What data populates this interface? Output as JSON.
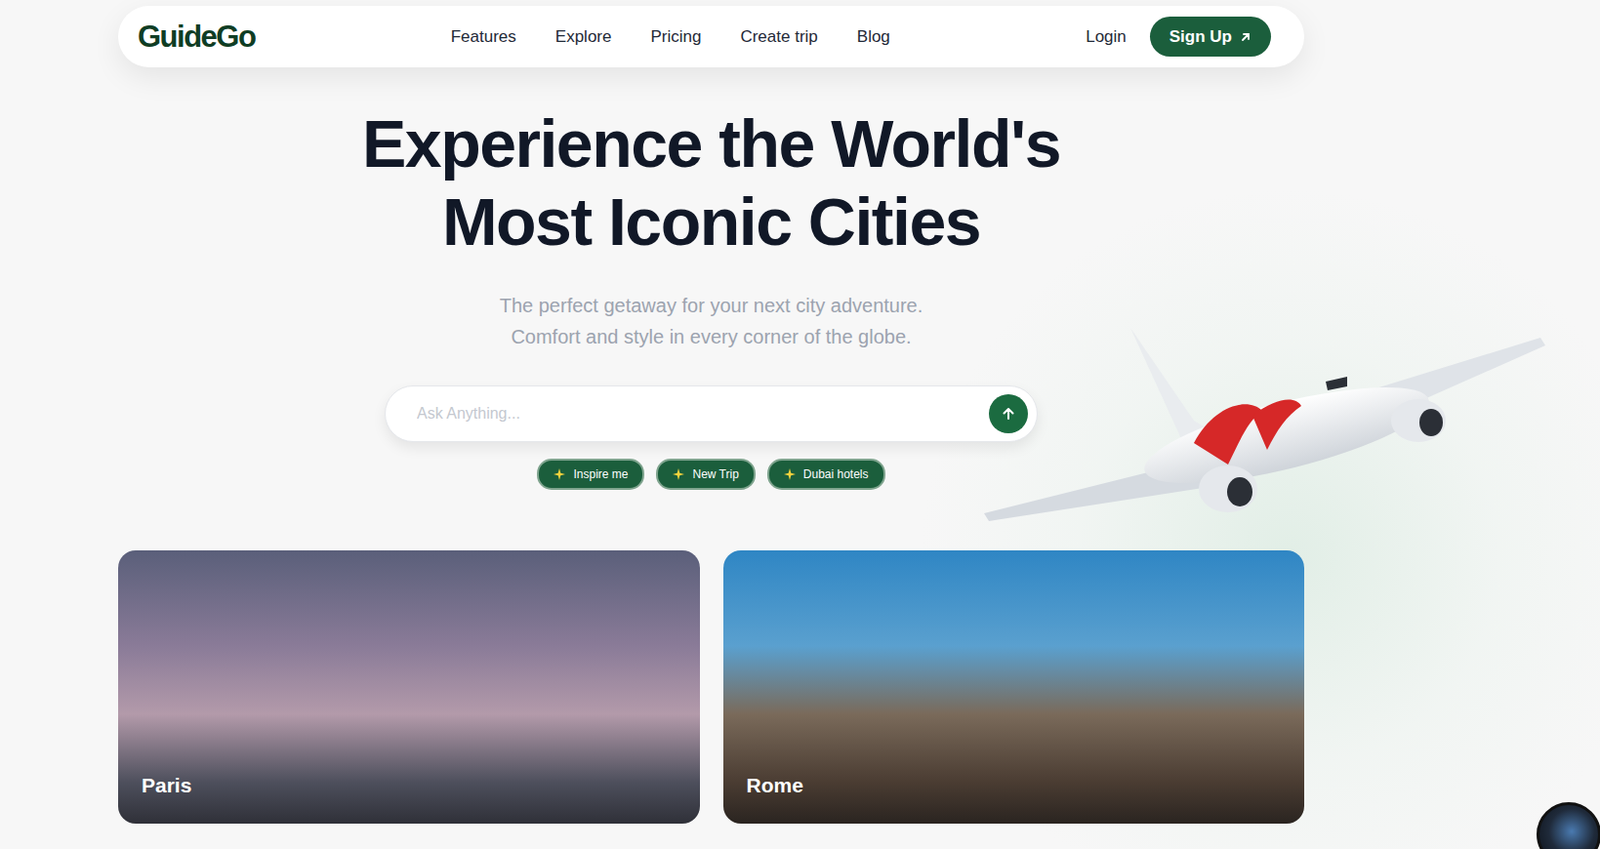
{
  "logo": {
    "text": "GuideGo"
  },
  "nav": {
    "links": [
      "Features",
      "Explore",
      "Pricing",
      "Create trip",
      "Blog"
    ]
  },
  "auth": {
    "login": "Login",
    "signup": "Sign Up"
  },
  "hero": {
    "title_lines": [
      "Experience the World's",
      "Most Iconic Cities"
    ],
    "subtitle_lines": [
      "The perfect getaway for your next city adventure.",
      "Comfort and style in every corner of the globe."
    ]
  },
  "search": {
    "placeholder": "Ask Anything..."
  },
  "chips": [
    {
      "label": "Inspire me"
    },
    {
      "label": "New Trip"
    },
    {
      "label": "Dubai hotels"
    }
  ],
  "cities": [
    {
      "name": "Paris"
    },
    {
      "name": "Rome"
    }
  ]
}
